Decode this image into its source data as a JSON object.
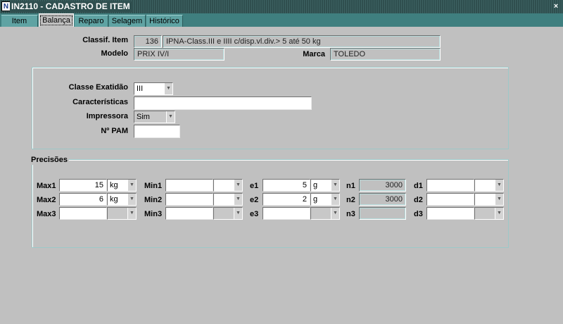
{
  "window": {
    "title": "IN2110 - CADASTRO DE ITEM",
    "app_icon_glyph": "N",
    "close_glyph": "×"
  },
  "tabs": [
    {
      "label": "Item",
      "active": false
    },
    {
      "label": "Balança",
      "active": true
    },
    {
      "label": "Reparo",
      "active": false
    },
    {
      "label": "Selagem",
      "active": false
    },
    {
      "label": "Histórico",
      "active": false
    }
  ],
  "header": {
    "classif_label": "Classif. Item",
    "classif_code": "136",
    "classif_desc": "IPNA-Class.III e IIII c/disp.vl.div.> 5 até 50 kg",
    "modelo_label": "Modelo",
    "modelo_value": "PRIX IV/I",
    "marca_label": "Marca",
    "marca_value": "TOLEDO"
  },
  "details": {
    "classe_label": "Classe Exatidão",
    "classe_value": "III",
    "caracteristicas_label": "Características",
    "caracteristicas_value": "",
    "impressora_label": "Impressora",
    "impressora_value": "Sim",
    "pam_label": "Nº PAM",
    "pam_value": ""
  },
  "precisoes": {
    "title": "Precisões",
    "rows": [
      {
        "max_label": "Max1",
        "max_value": "15",
        "max_unit": "kg",
        "min_label": "Min1",
        "min_value": "",
        "min_unit": "",
        "e_label": "e1",
        "e_value": "5",
        "e_unit": "g",
        "n_label": "n1",
        "n_value": "3000",
        "d_label": "d1",
        "d_value": "",
        "d_unit": ""
      },
      {
        "max_label": "Max2",
        "max_value": "6",
        "max_unit": "kg",
        "min_label": "Min2",
        "min_value": "",
        "min_unit": "",
        "e_label": "e2",
        "e_value": "2",
        "e_unit": "g",
        "n_label": "n2",
        "n_value": "3000",
        "d_label": "d2",
        "d_value": "",
        "d_unit": ""
      },
      {
        "max_label": "Max3",
        "max_value": "",
        "max_unit": "",
        "min_label": "Min3",
        "min_value": "",
        "min_unit": "",
        "e_label": "e3",
        "e_value": "",
        "e_unit": "",
        "n_label": "n3",
        "n_value": "",
        "d_label": "d3",
        "d_value": "",
        "d_unit": ""
      }
    ]
  },
  "colors": {
    "window_bg": "#c0c0c0",
    "titlebar_bg": "#2f4f4f",
    "tab_bg": "#5fa3a3",
    "group_border": "#9cc8c8"
  },
  "icons": {
    "dropdown": "chevron-down-icon",
    "close": "close-icon",
    "app": "app-icon"
  }
}
